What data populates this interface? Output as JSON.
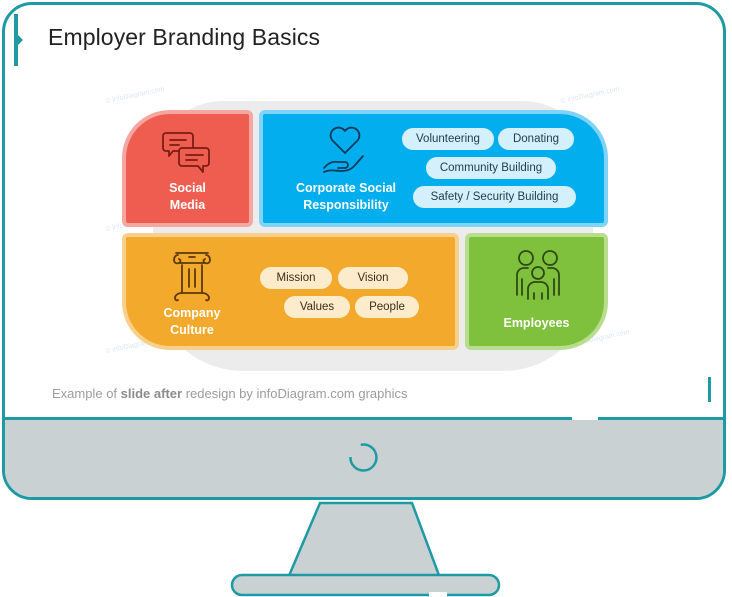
{
  "slide": {
    "title": "Employer Branding Basics",
    "watermark": "© infoDiagram.com",
    "caption": {
      "prefix": "Example of ",
      "bold": "slide after",
      "suffix": " redesign by infoDiagram.com graphics"
    }
  },
  "tiles": {
    "social_media": {
      "label_line1": "Social",
      "label_line2": "Media",
      "icon": "chat-bubbles-icon",
      "color": "#ef5d50"
    },
    "csr": {
      "label_line1": "Corporate Social",
      "label_line2": "Responsibility",
      "icon": "heart-in-hand-icon",
      "color": "#03aeef",
      "pills": [
        "Volunteering",
        "Donating",
        "Community Building",
        "Safety / Security Building"
      ]
    },
    "culture": {
      "label_line1": "Company",
      "label_line2": "Culture",
      "icon": "column-pillar-icon",
      "color": "#f3a92b",
      "pills": [
        "Mission",
        "Vision",
        "Values",
        "People"
      ]
    },
    "employees": {
      "label": "Employees",
      "icon": "family-people-icon",
      "color": "#7fc13d"
    }
  },
  "monitor": {
    "frame_color": "#1e9aa4",
    "bezel_color": "#c9d1d3",
    "power_icon": "power-icon"
  }
}
